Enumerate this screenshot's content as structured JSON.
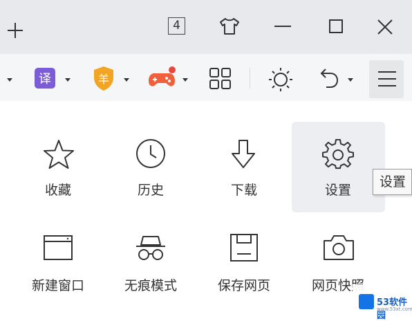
{
  "titlebar": {
    "new_tab_glyph": "+",
    "tab_count": "4",
    "icons": [
      "plus-icon",
      "tab-count-icon",
      "skin-shirt-icon",
      "minimize-icon",
      "maximize-icon",
      "close-icon"
    ]
  },
  "toolbar": {
    "icons": [
      "translate-icon",
      "coupon-shield-icon",
      "game-controller-icon",
      "apps-grid-icon",
      "brightness-icon",
      "undo-icon",
      "menu-icon"
    ],
    "translate_glyph": "译",
    "coupon_glyph": "羊",
    "colors": {
      "translate": "#7b5bd6",
      "coupon": "#f2a524",
      "game": "#f0603a",
      "game_badge": "#e8473b"
    }
  },
  "menu": {
    "items": [
      {
        "label": "收藏",
        "icon": "star-icon"
      },
      {
        "label": "历史",
        "icon": "clock-icon"
      },
      {
        "label": "下载",
        "icon": "download-arrow-icon"
      },
      {
        "label": "设置",
        "icon": "gear-icon",
        "highlighted": true
      },
      {
        "label": "新建窗口",
        "icon": "new-window-icon"
      },
      {
        "label": "无痕模式",
        "icon": "incognito-icon"
      },
      {
        "label": "保存网页",
        "icon": "save-page-icon"
      },
      {
        "label": "网页快照",
        "icon": "camera-icon"
      }
    ]
  },
  "tooltip": {
    "text": "设置"
  },
  "watermark": {
    "text": "53软件园",
    "sub": "www.53xt.com"
  }
}
